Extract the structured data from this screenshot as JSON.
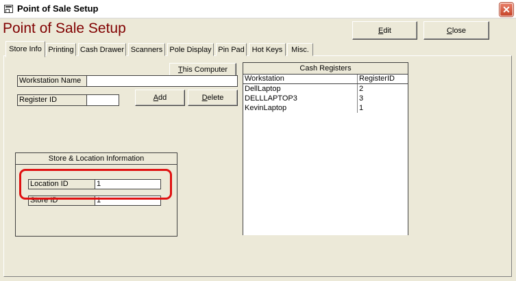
{
  "window": {
    "title": "Point of Sale Setup",
    "close_glyph": "✕"
  },
  "heading": "Point of Sale Setup",
  "actions": {
    "edit_label": "Edit",
    "close_label": "Close"
  },
  "tabs": [
    {
      "label": "Store Info",
      "active": true
    },
    {
      "label": "Printing"
    },
    {
      "label": "Cash Drawer"
    },
    {
      "label": "Scanners"
    },
    {
      "label": "Pole Display"
    },
    {
      "label": "Pin Pad"
    },
    {
      "label": "Hot Keys"
    },
    {
      "label": "Misc."
    }
  ],
  "store_info": {
    "this_computer_label": "This Computer",
    "workstation_name_label": "Workstation Name",
    "workstation_name_value": "",
    "register_id_label": "Register ID",
    "register_id_value": "",
    "add_label": "Add",
    "delete_label": "Delete",
    "location_group": {
      "title": "Store & Location Information",
      "location_id_label": "Location ID",
      "location_id_value": "1",
      "store_id_label": "Store ID",
      "store_id_value": "1"
    },
    "cash_registers": {
      "title": "Cash Registers",
      "columns": [
        "Workstation",
        "RegisterID"
      ],
      "rows": [
        {
          "workstation": "DellLaptop",
          "register_id": "2"
        },
        {
          "workstation": "DELLLAPTOP3",
          "register_id": "3"
        },
        {
          "workstation": "KevinLaptop",
          "register_id": "1"
        }
      ]
    }
  },
  "colors": {
    "heading": "#800000",
    "highlight": "#e01010",
    "background": "#ece9d8"
  }
}
